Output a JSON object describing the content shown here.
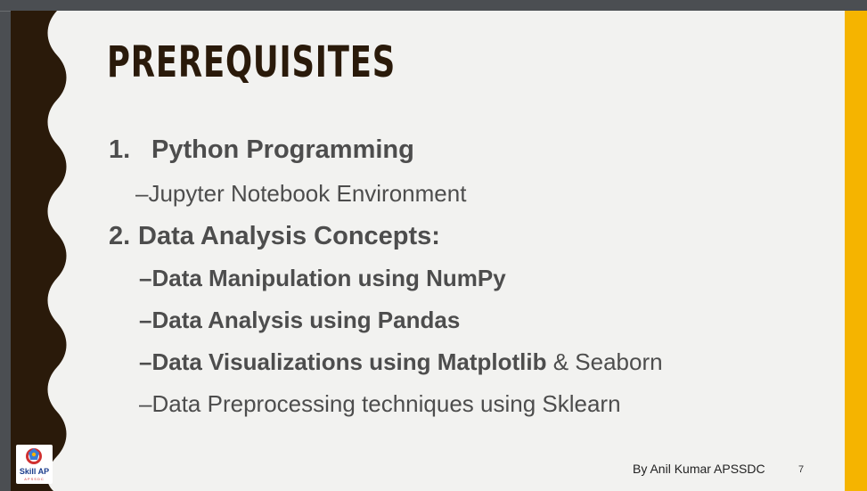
{
  "slide": {
    "title": "PREREQUISITES",
    "items": [
      {
        "number": "1.",
        "text": "Python Programming"
      },
      {
        "dash": "–",
        "text": "Jupyter Notebook Environment"
      },
      {
        "number": "2.",
        "text": "Data Analysis Concepts:"
      },
      {
        "dash": "–",
        "text": "Data Manipulation using NumPy"
      },
      {
        "dash": "–",
        "text": "Data Analysis using Pandas"
      },
      {
        "dash": "–",
        "text_bold": "Data Visualizations using Matplotlib",
        "text_rest": " & Seaborn"
      },
      {
        "dash": "–",
        "text": "Data Preprocessing techniques using Sklearn"
      }
    ],
    "footer": "By Anil Kumar APSSDC",
    "page_number": "7"
  },
  "logo": {
    "text": "Skill AP",
    "subtext": "APSSDC"
  },
  "colors": {
    "band_dark": "#2a1a0a",
    "accent_right": "#f5b400",
    "background": "#f2f2f0",
    "text": "#4d4d4d"
  }
}
